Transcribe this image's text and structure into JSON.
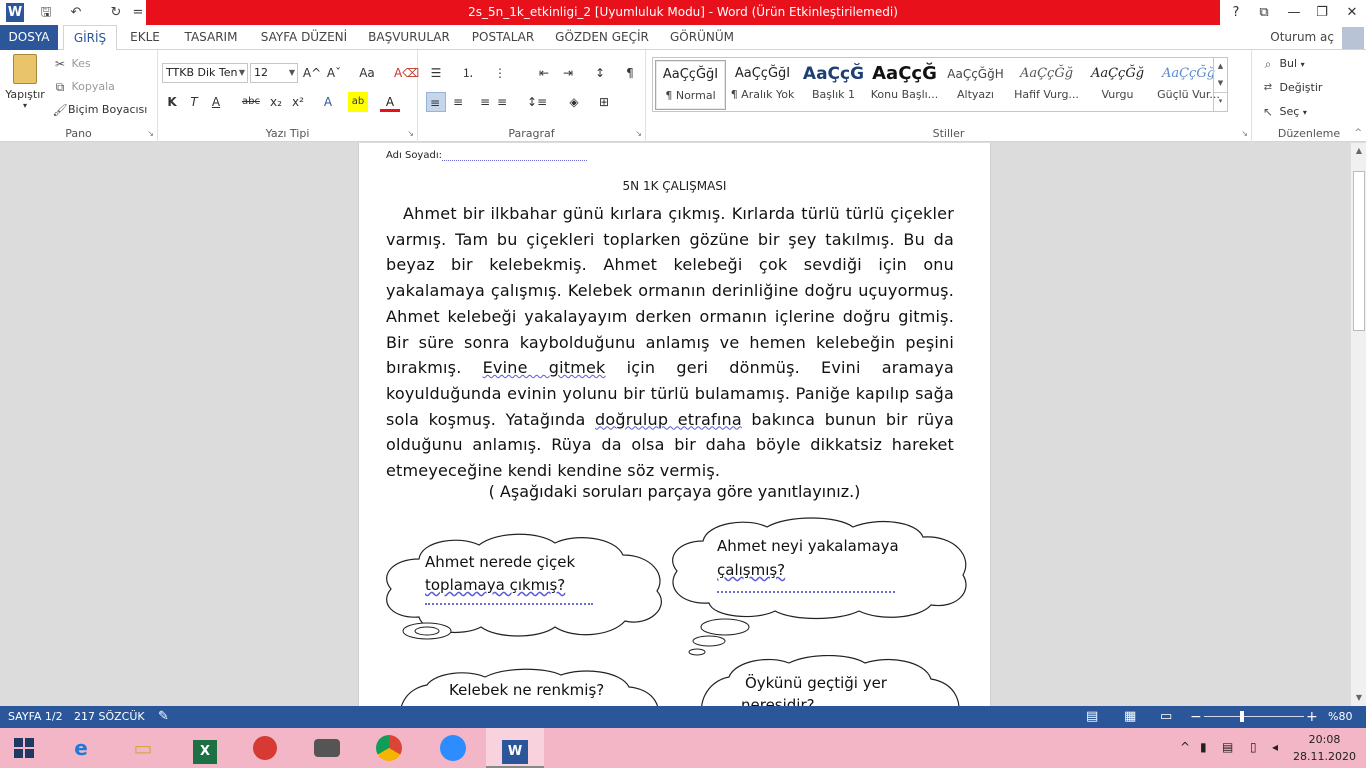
{
  "window": {
    "title": "2s_5n_1k_etkinligi_2 [Uyumluluk Modu] - Word (Ürün Etkinleştirilemedi)",
    "help": "?",
    "restore_ribbon": "⧉",
    "minimize": "—",
    "maximize": "❐",
    "close": "✕"
  },
  "quick_access": {
    "word_icon": "W",
    "save": "🖫",
    "undo": "↶",
    "redo": "↻",
    "more": "="
  },
  "tabs": [
    "DOSYA",
    "GİRİŞ",
    "EKLE",
    "TASARIM",
    "SAYFA DÜZENİ",
    "BAŞVURULAR",
    "POSTALAR",
    "GÖZDEN GEÇİR",
    "GÖRÜNÜM"
  ],
  "signin": "Oturum aç",
  "clipboard": {
    "label": "Pano",
    "paste": "Yapıştır",
    "cut": "Kes",
    "copy": "Kopyala",
    "format_painter": "Biçim Boyacısı"
  },
  "font": {
    "label": "Yazı Tipi",
    "family": "TTKB Dik Ten",
    "size": "12",
    "bold": "K",
    "italic": "T",
    "underline": "A",
    "strike": "abc",
    "sub": "x₂",
    "sup": "x²",
    "grow": "A^",
    "shrink": "Aˇ",
    "case": "Aa",
    "clear": "A⌫",
    "effects": "A",
    "highlight": "ab",
    "color": "A"
  },
  "paragraph": {
    "label": "Paragraf",
    "bullets": "☰",
    "numbering": "⒈",
    "multilevel": "⋮",
    "outdent": "⇤",
    "indent": "⇥",
    "sort": "↕",
    "pilcrow": "¶",
    "align_left": "≡",
    "align_center": "≡",
    "align_right": "≡",
    "justify": "≡",
    "line_spacing": "↕≡",
    "shading": "◈",
    "borders": "⊞"
  },
  "styles": {
    "label": "Stiller",
    "items": [
      {
        "preview": "AaÇçĞğI",
        "name": "¶ Normal"
      },
      {
        "preview": "AaÇçĞğI",
        "name": "¶ Aralık Yok"
      },
      {
        "preview": "AaÇçĞ",
        "name": "Başlık 1"
      },
      {
        "preview": "AaÇçĞ",
        "name": "Konu Başlı..."
      },
      {
        "preview": "AaÇçĞğH",
        "name": "Altyazı"
      },
      {
        "preview": "AaÇçĞğ",
        "name": "Hafif Vurg..."
      },
      {
        "preview": "AaÇçĞğ",
        "name": "Vurgu"
      },
      {
        "preview": "AaÇçĞğ",
        "name": "Güçlü Vur..."
      }
    ]
  },
  "editing": {
    "label": "Düzenleme",
    "find": "Bul",
    "replace": "Değiştir",
    "select": "Seç"
  },
  "document": {
    "name_label": "Adı Soyadı:",
    "title": "5N 1K ÇALIŞMASI",
    "story": {
      "p1": "Ahmet bir ilkbahar günü kırlara çıkmış. Kırlarda türlü türlü çiçekler varmış. Tam bu çiçekleri toplarken gözüne bir şey takılmış. Bu da beyaz bir kelebekmiş. Ahmet kelebeği çok sevdiği için onu yakalamaya çalışmış. Kelebek ormanın derinliğine doğru uçuyormuş. Ahmet kelebeği yakalayayım derken ormanın içlerine doğru gitmiş.   Bir süre sonra kaybolduğunu anlamış ve hemen kelebeğin peşini bırakmış. ",
      "s1": "Evine  gitmek",
      "p2": " için geri dönmüş. Evini aramaya koyulduğunda evinin yolunu bir türlü bulamamış. Paniğe kapılıp sağa sola koşmuş. Yatağında ",
      "s2": "doğrulup  etrafına",
      "p3": " bakınca bunun bir rüya olduğunu anlamış. Rüya da olsa bir daha böyle dikkatsiz hareket etmeyeceğine kendi kendine söz vermiş."
    },
    "instruction": "( Aşağıdaki soruları parçaya göre yanıtlayınız.)",
    "questions": [
      {
        "line1": "Ahmet nerede çiçek",
        "line2": "toplamaya  çıkmış?"
      },
      {
        "line1": "Ahmet neyi yakalamaya",
        "line2": "çalışmış?"
      },
      {
        "line1": "Kelebek ne renkmiş?"
      },
      {
        "line1": "Öykünü  geçtiği yer",
        "line2": "neresidir?"
      }
    ]
  },
  "statusbar": {
    "page": "SAYFA 1/2",
    "words": "217 SÖZCÜK",
    "zoom_minus": "−",
    "zoom_plus": "+",
    "zoom": "%80",
    "zoom_level": 0.8
  },
  "taskbar": {
    "time": "20:08",
    "date": "28.11.2020",
    "apps": [
      "start",
      "internet-explorer",
      "file-explorer",
      "excel",
      "app-red",
      "app-camera",
      "chrome",
      "zoom",
      "word"
    ]
  },
  "colors": {
    "word_blue": "#2b579a",
    "title_red": "#e8111b",
    "taskbar_pink": "#f3b6c6"
  }
}
